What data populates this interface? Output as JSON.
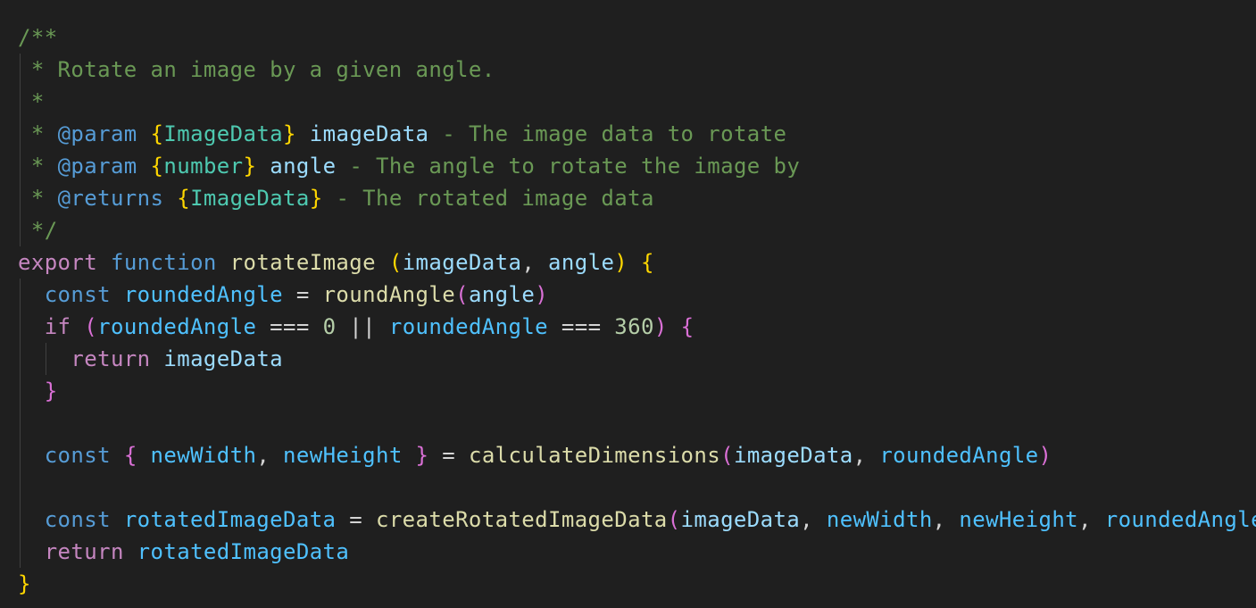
{
  "colors": {
    "background": "#1f1f1f",
    "comment": "#6a9955",
    "doc_tag": "#569cd6",
    "doc_type": "#4ec9b0",
    "doc_param_name": "#9cdcfe",
    "keyword_control": "#c586c0",
    "keyword_storage": "#569cd6",
    "function_name": "#dcdcaa",
    "variable": "#9cdcfe",
    "constant": "#4fc1ff",
    "number": "#b5cea8",
    "operator": "#d4d4d4",
    "bracket_level1": "#ffd700",
    "bracket_level2": "#da70d6",
    "bracket_level3": "#179fff"
  },
  "code": {
    "lines": [
      {
        "indent": 0,
        "guides": 0,
        "tokens": [
          {
            "t": "/**",
            "c": "comment"
          }
        ]
      },
      {
        "indent": 0,
        "guides": 1,
        "tokens": [
          {
            "t": " * Rotate an image by a given angle.",
            "c": "comment"
          }
        ]
      },
      {
        "indent": 0,
        "guides": 1,
        "tokens": [
          {
            "t": " *",
            "c": "comment"
          }
        ]
      },
      {
        "indent": 0,
        "guides": 1,
        "tokens": [
          {
            "t": " * ",
            "c": "comment"
          },
          {
            "t": "@param",
            "c": "doc_tag"
          },
          {
            "t": " ",
            "c": "comment"
          },
          {
            "t": "{",
            "c": "bracket_level1"
          },
          {
            "t": "ImageData",
            "c": "doc_type"
          },
          {
            "t": "}",
            "c": "bracket_level1"
          },
          {
            "t": " ",
            "c": "comment"
          },
          {
            "t": "imageData",
            "c": "doc_param_name"
          },
          {
            "t": " - The image data to rotate",
            "c": "comment"
          }
        ]
      },
      {
        "indent": 0,
        "guides": 1,
        "tokens": [
          {
            "t": " * ",
            "c": "comment"
          },
          {
            "t": "@param",
            "c": "doc_tag"
          },
          {
            "t": " ",
            "c": "comment"
          },
          {
            "t": "{",
            "c": "bracket_level1"
          },
          {
            "t": "number",
            "c": "doc_type"
          },
          {
            "t": "}",
            "c": "bracket_level1"
          },
          {
            "t": " ",
            "c": "comment"
          },
          {
            "t": "angle",
            "c": "doc_param_name"
          },
          {
            "t": " - The angle to rotate the image by",
            "c": "comment"
          }
        ]
      },
      {
        "indent": 0,
        "guides": 1,
        "tokens": [
          {
            "t": " * ",
            "c": "comment"
          },
          {
            "t": "@returns",
            "c": "doc_tag"
          },
          {
            "t": " ",
            "c": "comment"
          },
          {
            "t": "{",
            "c": "bracket_level1"
          },
          {
            "t": "ImageData",
            "c": "doc_type"
          },
          {
            "t": "}",
            "c": "bracket_level1"
          },
          {
            "t": " - The rotated image data",
            "c": "comment"
          }
        ]
      },
      {
        "indent": 0,
        "guides": 1,
        "tokens": [
          {
            "t": " */",
            "c": "comment"
          }
        ]
      },
      {
        "indent": 0,
        "guides": 0,
        "tokens": [
          {
            "t": "export",
            "c": "keyword_control"
          },
          {
            "t": " ",
            "c": "operator"
          },
          {
            "t": "function",
            "c": "keyword_storage"
          },
          {
            "t": " ",
            "c": "operator"
          },
          {
            "t": "rotateImage",
            "c": "function_name"
          },
          {
            "t": " ",
            "c": "operator"
          },
          {
            "t": "(",
            "c": "bracket_level1"
          },
          {
            "t": "imageData",
            "c": "variable"
          },
          {
            "t": ", ",
            "c": "operator"
          },
          {
            "t": "angle",
            "c": "variable"
          },
          {
            "t": ")",
            "c": "bracket_level1"
          },
          {
            "t": " ",
            "c": "operator"
          },
          {
            "t": "{",
            "c": "bracket_level1"
          }
        ]
      },
      {
        "indent": 0,
        "guides": 1,
        "tokens": [
          {
            "t": "  ",
            "c": "operator"
          },
          {
            "t": "const",
            "c": "keyword_storage"
          },
          {
            "t": " ",
            "c": "operator"
          },
          {
            "t": "roundedAngle",
            "c": "constant"
          },
          {
            "t": " = ",
            "c": "operator"
          },
          {
            "t": "roundAngle",
            "c": "function_name"
          },
          {
            "t": "(",
            "c": "bracket_level2"
          },
          {
            "t": "angle",
            "c": "variable"
          },
          {
            "t": ")",
            "c": "bracket_level2"
          }
        ]
      },
      {
        "indent": 0,
        "guides": 1,
        "tokens": [
          {
            "t": "  ",
            "c": "operator"
          },
          {
            "t": "if",
            "c": "keyword_control"
          },
          {
            "t": " ",
            "c": "operator"
          },
          {
            "t": "(",
            "c": "bracket_level2"
          },
          {
            "t": "roundedAngle",
            "c": "constant"
          },
          {
            "t": " === ",
            "c": "operator"
          },
          {
            "t": "0",
            "c": "number"
          },
          {
            "t": " || ",
            "c": "operator"
          },
          {
            "t": "roundedAngle",
            "c": "constant"
          },
          {
            "t": " === ",
            "c": "operator"
          },
          {
            "t": "360",
            "c": "number"
          },
          {
            "t": ")",
            "c": "bracket_level2"
          },
          {
            "t": " ",
            "c": "operator"
          },
          {
            "t": "{",
            "c": "bracket_level2"
          }
        ]
      },
      {
        "indent": 0,
        "guides": 2,
        "tokens": [
          {
            "t": "    ",
            "c": "operator"
          },
          {
            "t": "return",
            "c": "keyword_control"
          },
          {
            "t": " ",
            "c": "operator"
          },
          {
            "t": "imageData",
            "c": "variable"
          }
        ]
      },
      {
        "indent": 0,
        "guides": 1,
        "tokens": [
          {
            "t": "  ",
            "c": "operator"
          },
          {
            "t": "}",
            "c": "bracket_level2"
          }
        ]
      },
      {
        "indent": 0,
        "guides": 1,
        "tokens": []
      },
      {
        "indent": 0,
        "guides": 1,
        "tokens": [
          {
            "t": "  ",
            "c": "operator"
          },
          {
            "t": "const",
            "c": "keyword_storage"
          },
          {
            "t": " ",
            "c": "operator"
          },
          {
            "t": "{",
            "c": "bracket_level2"
          },
          {
            "t": " ",
            "c": "operator"
          },
          {
            "t": "newWidth",
            "c": "constant"
          },
          {
            "t": ", ",
            "c": "operator"
          },
          {
            "t": "newHeight",
            "c": "constant"
          },
          {
            "t": " ",
            "c": "operator"
          },
          {
            "t": "}",
            "c": "bracket_level2"
          },
          {
            "t": " = ",
            "c": "operator"
          },
          {
            "t": "calculateDimensions",
            "c": "function_name"
          },
          {
            "t": "(",
            "c": "bracket_level2"
          },
          {
            "t": "imageData",
            "c": "variable"
          },
          {
            "t": ", ",
            "c": "operator"
          },
          {
            "t": "roundedAngle",
            "c": "constant"
          },
          {
            "t": ")",
            "c": "bracket_level2"
          }
        ]
      },
      {
        "indent": 0,
        "guides": 1,
        "tokens": []
      },
      {
        "indent": 0,
        "guides": 1,
        "tokens": [
          {
            "t": "  ",
            "c": "operator"
          },
          {
            "t": "const",
            "c": "keyword_storage"
          },
          {
            "t": " ",
            "c": "operator"
          },
          {
            "t": "rotatedImageData",
            "c": "constant"
          },
          {
            "t": " = ",
            "c": "operator"
          },
          {
            "t": "createRotatedImageData",
            "c": "function_name"
          },
          {
            "t": "(",
            "c": "bracket_level2"
          },
          {
            "t": "imageData",
            "c": "variable"
          },
          {
            "t": ", ",
            "c": "operator"
          },
          {
            "t": "newWidth",
            "c": "constant"
          },
          {
            "t": ", ",
            "c": "operator"
          },
          {
            "t": "newHeight",
            "c": "constant"
          },
          {
            "t": ", ",
            "c": "operator"
          },
          {
            "t": "roundedAngle",
            "c": "constant"
          },
          {
            "t": ")",
            "c": "bracket_level2"
          }
        ]
      },
      {
        "indent": 0,
        "guides": 1,
        "tokens": [
          {
            "t": "  ",
            "c": "operator"
          },
          {
            "t": "return",
            "c": "keyword_control"
          },
          {
            "t": " ",
            "c": "operator"
          },
          {
            "t": "rotatedImageData",
            "c": "constant"
          }
        ]
      },
      {
        "indent": 0,
        "guides": 0,
        "tokens": [
          {
            "t": "}",
            "c": "bracket_level1"
          }
        ]
      }
    ]
  }
}
